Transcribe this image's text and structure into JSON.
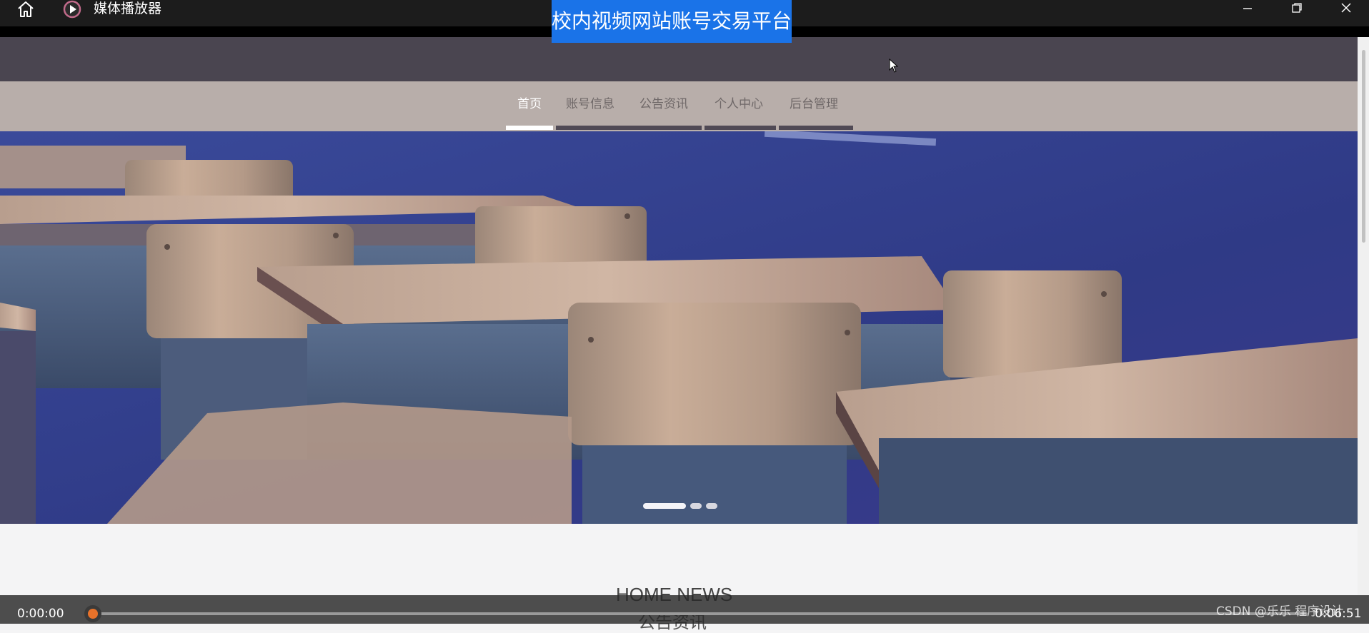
{
  "player": {
    "app_title": "媒体播放器",
    "icons": [
      "home-icon",
      "play-circle-icon",
      "minimize-icon",
      "restore-icon",
      "close-icon"
    ],
    "accent_color": "#e8722a",
    "current_time": "0:00:00",
    "total_time": "0:06:51",
    "progress": 0.0,
    "watermark": "CSDN @乐乐 程序设计"
  },
  "site": {
    "title": "校内视频网站账号交易平台",
    "title_highlight_color": "#1a73e8",
    "nav": [
      {
        "label": "首页",
        "active": true
      },
      {
        "label": "账号信息",
        "active": false
      },
      {
        "label": "公告资讯",
        "active": false
      },
      {
        "label": "个人中心",
        "active": false
      },
      {
        "label": "后台管理",
        "active": false
      }
    ],
    "banner": {
      "slide_count": 3,
      "active_slide": 1
    },
    "section": {
      "title": "HOME NEWS",
      "subtitle": "公告资讯"
    }
  }
}
